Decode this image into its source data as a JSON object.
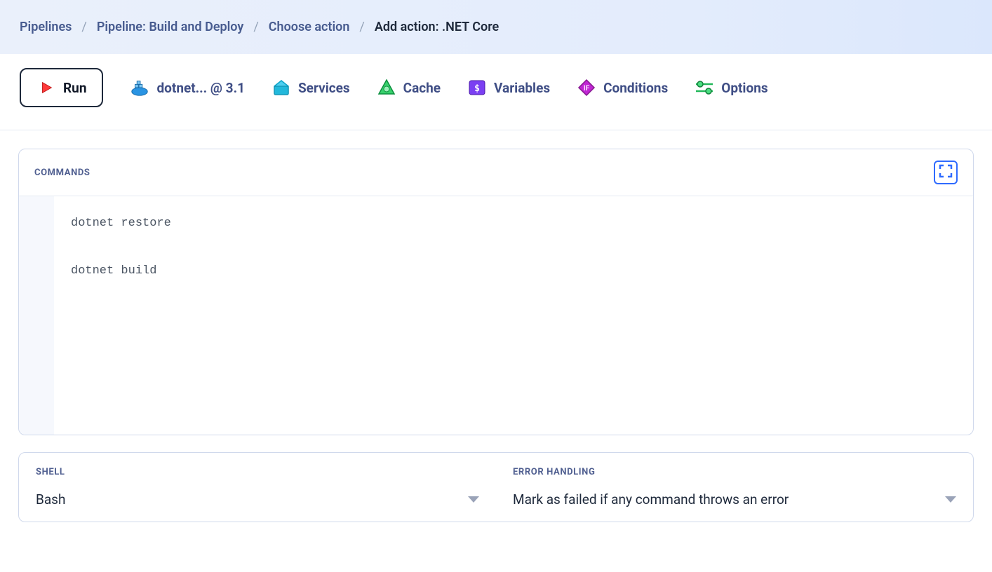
{
  "breadcrumb": {
    "items": [
      "Pipelines",
      "Pipeline: Build and Deploy",
      "Choose action"
    ],
    "current": "Add action: .NET Core"
  },
  "tabs": {
    "run": "Run",
    "docker": "dotnet... @ 3.1",
    "services": "Services",
    "cache": "Cache",
    "variables": "Variables",
    "conditions": "Conditions",
    "options": "Options"
  },
  "commands": {
    "title": "COMMANDS",
    "code": "dotnet restore\n\ndotnet build"
  },
  "shell": {
    "title": "SHELL",
    "value": "Bash"
  },
  "error_handling": {
    "title": "ERROR HANDLING",
    "value": "Mark as failed if any command throws an error"
  }
}
